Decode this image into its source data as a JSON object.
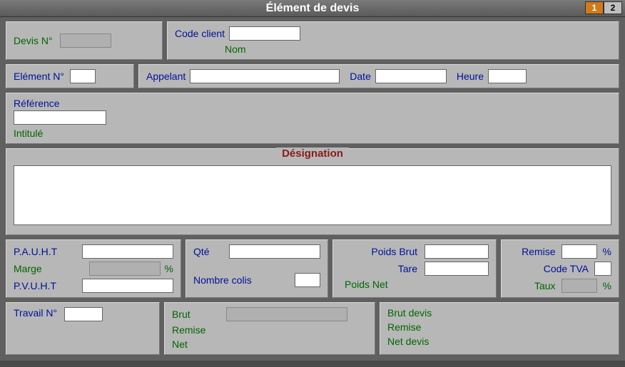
{
  "title": "Élément de devis",
  "tabs": {
    "t1": "1",
    "t2": "2"
  },
  "top": {
    "devis_no_label": "Devis N°",
    "devis_no": "",
    "code_client_label": "Code client",
    "code_client": "",
    "nom_label": "Nom",
    "element_no_label": "Elément N°",
    "element_no": "",
    "appelant_label": "Appelant",
    "appelant": "",
    "date_label": "Date",
    "date": "",
    "heure_label": "Heure",
    "heure": ""
  },
  "ref": {
    "reference_label": "Référence",
    "reference": "",
    "intitule_label": "Intitulé"
  },
  "designation_label": "Désignation",
  "designation": "",
  "prices": {
    "pauht_label": "P.A.U.H.T",
    "pauht": "",
    "marge_label": "Marge",
    "marge": "",
    "percent": "%",
    "pvuht_label": "P.V.U.H.T",
    "pvuht": ""
  },
  "qty": {
    "qte_label": "Qté",
    "qte": "",
    "nombre_colis_label": "Nombre colis",
    "nombre_colis": ""
  },
  "poids": {
    "brut_label": "Poids Brut",
    "brut": "",
    "tare_label": "Tare",
    "tare": "",
    "net_label": "Poids Net"
  },
  "remise": {
    "remise_label": "Remise",
    "remise": "",
    "percent": "%",
    "code_tva_label": "Code TVA",
    "code_tva": "",
    "taux_label": "Taux",
    "taux": ""
  },
  "travail": {
    "label": "Travail N°",
    "value": ""
  },
  "totals_left": {
    "brut_label": "Brut",
    "brut": "",
    "remise_label": "Remise",
    "net_label": "Net"
  },
  "totals_right": {
    "brut_label": "Brut devis",
    "remise_label": "Remise",
    "net_label": "Net devis"
  }
}
